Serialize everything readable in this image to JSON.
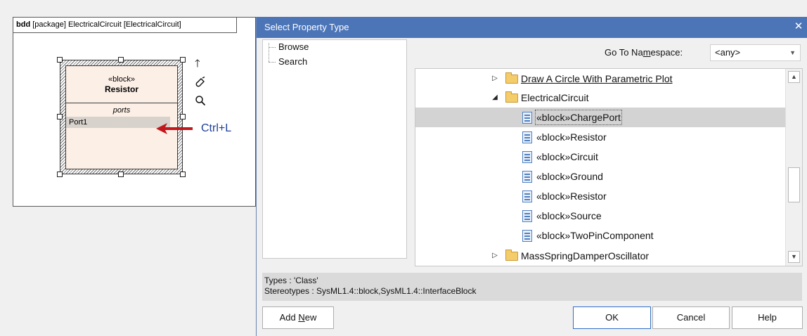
{
  "diagram": {
    "header_keyword": "bdd",
    "header_rest": " [package] ElectricalCircuit [ElectricalCircuit]",
    "block": {
      "stereotype": "«block»",
      "name": "Resistor",
      "compartment_label": "ports",
      "port": "Port1"
    },
    "shortcut_label": "Ctrl+L"
  },
  "dialog": {
    "title": "Select Property Type",
    "close_glyph": "✕",
    "nav": [
      {
        "label": "Browse"
      },
      {
        "label": "Search"
      }
    ],
    "namespace_label_pre": "Go To Na",
    "namespace_label_key": "m",
    "namespace_label_post": "espace:",
    "namespace_value": "<any>",
    "tree": [
      {
        "label": "Draw A Circle With Parametric Plot",
        "kind": "folder",
        "expander": "▷",
        "link": true
      },
      {
        "label": "ElectricalCircuit",
        "kind": "folder",
        "expander": "◢"
      },
      {
        "label": "«block»ChargePort",
        "kind": "class",
        "selected": true
      },
      {
        "label": "«block»Resistor",
        "kind": "class"
      },
      {
        "label": "«block»Circuit",
        "kind": "class"
      },
      {
        "label": "«block»Ground",
        "kind": "class"
      },
      {
        "label": "«block»Resistor",
        "kind": "class"
      },
      {
        "label": "«block»Source",
        "kind": "class"
      },
      {
        "label": "«block»TwoPinComponent",
        "kind": "class"
      },
      {
        "label": "MassSpringDamperOscillator",
        "kind": "folder",
        "expander": "▷"
      }
    ],
    "info_types": "Types : 'Class'",
    "info_stereotypes": "Stereotypes : SysML1.4::block,SysML1.4::InterfaceBlock",
    "buttons": {
      "add_new_pre": "Add ",
      "add_new_key": "N",
      "add_new_post": "ew",
      "ok": "OK",
      "cancel": "Cancel",
      "help": "Help"
    }
  },
  "colors": {
    "titlebar": "#4c75b8",
    "block_fill": "#fcefe6",
    "arrow": "#c0181c",
    "shortcut_text": "#1f3f99"
  }
}
